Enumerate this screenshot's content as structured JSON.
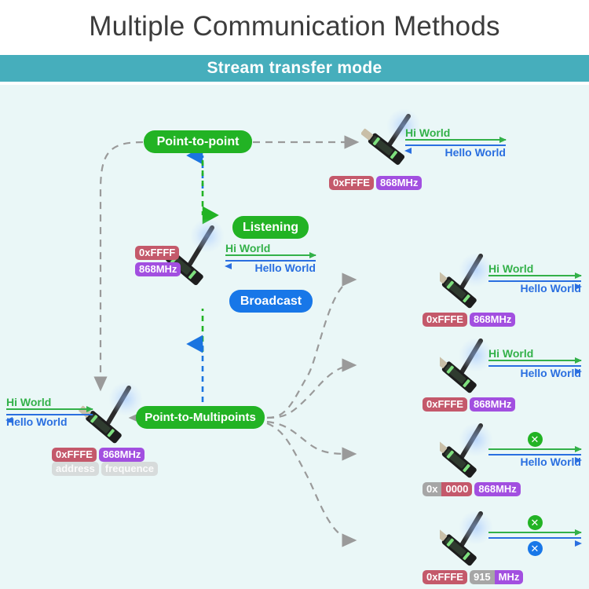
{
  "header": {
    "title": "Multiple Communication Methods",
    "subtitle": "Stream transfer mode",
    "band_color": "#46aebc",
    "canvas_color": "#eaf7f7"
  },
  "nodes": {
    "point_to_point": "Point-to-point",
    "point_to_multipoints": "Point-to-Multipoints",
    "listening": "Listening",
    "broadcast": "Broadcast"
  },
  "messages": {
    "tx": "Hi World",
    "rx": "Hello World",
    "blocked_icon": "cross-icon"
  },
  "legend": {
    "address": "address",
    "frequence": "frequence"
  },
  "devices": [
    {
      "id": "top-right",
      "address": "0xFFFE",
      "frequency": "868MHz",
      "tx": "Hi World",
      "rx": "Hello World",
      "tx_blocked": false,
      "rx_blocked": false
    },
    {
      "id": "center-hub",
      "address": "0xFFFF",
      "frequency": "868MHz",
      "tx": "Hi World",
      "rx": "Hello World",
      "tx_blocked": false,
      "rx_blocked": false
    },
    {
      "id": "left-hub",
      "address": "0xFFFE",
      "frequency": "868MHz",
      "tx": "Hi World",
      "rx": "Hello World",
      "tx_blocked": false,
      "rx_blocked": false
    },
    {
      "id": "right-1",
      "address": "0xFFFE",
      "frequency": "868MHz",
      "tx": "Hi World",
      "rx": "Hello World",
      "tx_blocked": false,
      "rx_blocked": false
    },
    {
      "id": "right-2",
      "address": "0xFFFE",
      "frequency": "868MHz",
      "tx": "Hi World",
      "rx": "Hello World",
      "tx_blocked": false,
      "rx_blocked": false
    },
    {
      "id": "right-3",
      "address": "0x0000",
      "frequency": "868MHz",
      "tx": "",
      "rx": "Hello World",
      "tx_blocked": true,
      "rx_blocked": false
    },
    {
      "id": "right-4",
      "address": "0xFFFE",
      "frequency": "915MHz",
      "tx": "",
      "rx": "",
      "tx_blocked": true,
      "rx_blocked": true
    }
  ],
  "tags": {
    "d1_addr": "0xFFFE",
    "d1_freq": "868MHz",
    "d2_addr": "0xFFFF",
    "d2_freq": "868MHz",
    "d3_addr": "0xFFFE",
    "d3_freq": "868MHz",
    "d4_addr": "0xFFFE",
    "d4_freq": "868MHz",
    "d5_addr": "0xFFFE",
    "d5_freq": "868MHz",
    "d6_addr_prefix": "0x",
    "d6_addr_value": "0000",
    "d6_freq": "868MHz",
    "d7_addr": "0xFFFE",
    "d7_freq_value": "915",
    "d7_freq_unit": "MHz"
  },
  "msg_labels": {
    "m1_tx": "Hi World",
    "m1_rx": "Hello World",
    "m2_tx": "Hi World",
    "m2_rx": "Hello World",
    "m3_tx": "Hi World",
    "m3_rx": "Hello World",
    "m4_tx": "Hi World",
    "m4_rx": "Hello World",
    "m5_tx": "Hi World",
    "m5_rx": "Hello World",
    "m6_rx": "Hello World"
  },
  "colors": {
    "green": "#22b324",
    "blue": "#1877e8",
    "tx_green": "#33b149",
    "rx_blue": "#2a6fe0",
    "addr_red": "#c4596b",
    "freq_purple": "#a24fe0",
    "muted_gray": "#a6a6a6",
    "dashed_gray": "#9a9a9a"
  }
}
